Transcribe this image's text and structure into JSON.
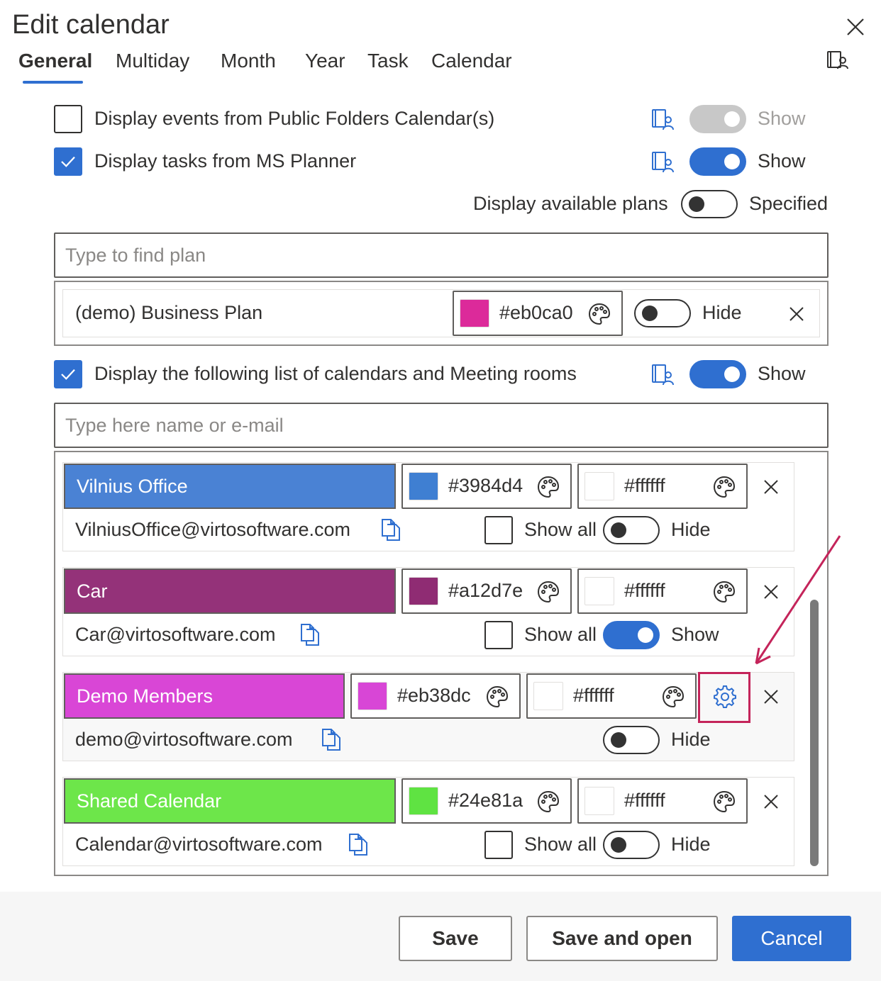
{
  "dialog": {
    "title": "Edit calendar"
  },
  "tabs": [
    {
      "label": "General",
      "active": true
    },
    {
      "label": "Multiday"
    },
    {
      "label": "Month"
    },
    {
      "label": "Year"
    },
    {
      "label": "Task"
    },
    {
      "label": "Calendar"
    }
  ],
  "options": {
    "public_folders": {
      "label": "Display events from Public Folders Calendar(s)",
      "checked": false,
      "toggle_label": "Show",
      "toggle_state": "disabled"
    },
    "ms_planner": {
      "label": "Display tasks from MS Planner",
      "checked": true,
      "toggle_label": "Show",
      "toggle_state": "on"
    },
    "available_plans": {
      "label": "Display available plans",
      "toggle_label": "Specified",
      "toggle_state": "off"
    },
    "calendars_list": {
      "label": "Display the following list of calendars and Meeting rooms",
      "checked": true,
      "toggle_label": "Show",
      "toggle_state": "on"
    }
  },
  "plan_search": {
    "placeholder": "Type to find plan"
  },
  "plans": [
    {
      "name": "(demo) Business Plan",
      "color": "#eb0ca0",
      "toggle_label": "Hide",
      "toggle_state": "off"
    }
  ],
  "calendar_search": {
    "placeholder": "Type here name or e-mail"
  },
  "calendars": [
    {
      "name": "Vilnius Office",
      "email": "VilniusOffice@virtosoftware.com",
      "color": "#3984d4",
      "bg_hex": "#ffffff",
      "show_all_label": "Show all",
      "show_all_checked": false,
      "toggle_label": "Hide",
      "toggle_state": "off"
    },
    {
      "name": "Car",
      "email": "Car@virtosoftware.com",
      "color": "#a12d7e",
      "bg_hex": "#ffffff",
      "show_all_label": "Show all",
      "show_all_checked": false,
      "toggle_label": "Show",
      "toggle_state": "on"
    },
    {
      "name": "Demo Members",
      "email": "demo@virtosoftware.com",
      "color": "#eb38dc",
      "bg_hex": "#ffffff",
      "toggle_label": "Hide",
      "toggle_state": "off",
      "has_settings": true
    },
    {
      "name": "Shared Calendar",
      "email": "Calendar@virtosoftware.com",
      "color": "#24e81a",
      "bg_hex": "#ffffff",
      "show_all_label": "Show all",
      "show_all_checked": false,
      "toggle_label": "Hide",
      "toggle_state": "off"
    }
  ],
  "footer": {
    "save_label": "Save",
    "save_open_label": "Save and open",
    "cancel_label": "Cancel"
  },
  "colors": {
    "accent": "#2f6fd0",
    "highlight": "#c4245a",
    "calendar_bar_vilnius": "#4a82d4",
    "calendar_bar_car": "#943279",
    "calendar_bar_demo": "#d946d6",
    "calendar_bar_shared": "#6de64a"
  },
  "icons": [
    "close-icon",
    "address-book-icon",
    "checkmark-icon",
    "palette-icon",
    "remove-icon",
    "copy-icon",
    "gear-icon"
  ]
}
